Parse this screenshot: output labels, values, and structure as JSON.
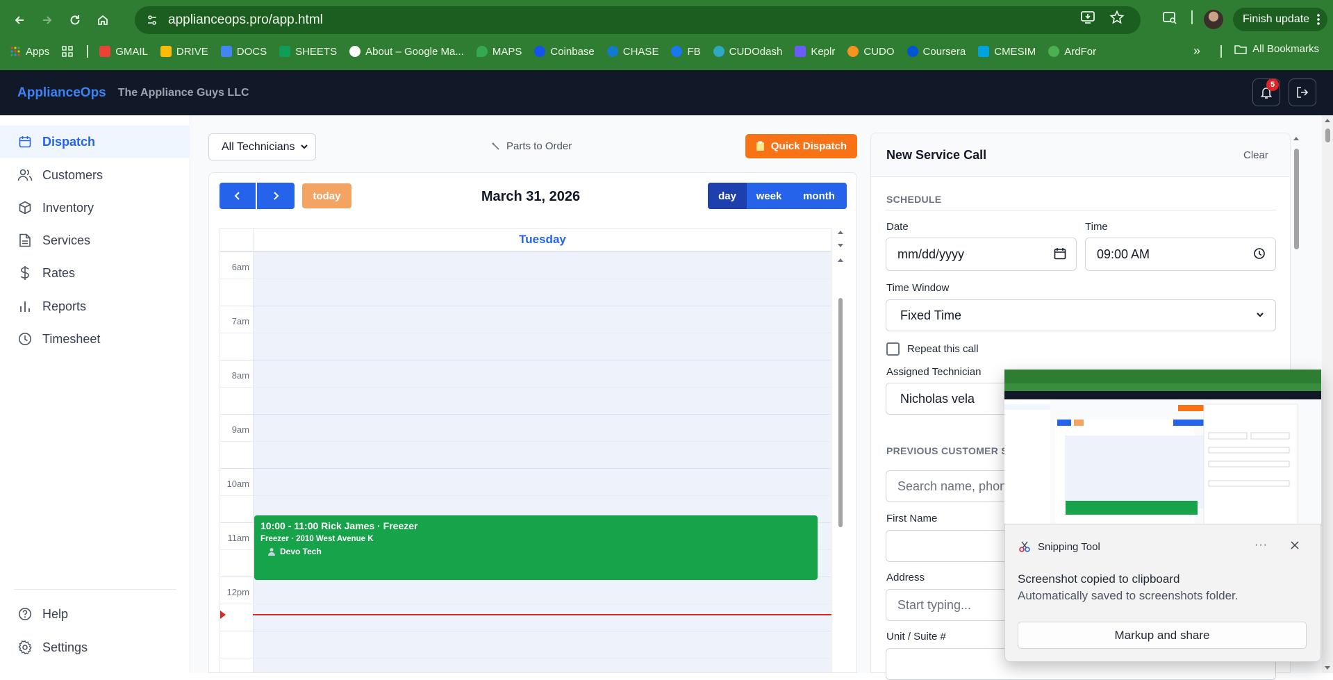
{
  "browser": {
    "url": "applianceops.pro/app.html",
    "update_label": "Finish update",
    "bookmarks": [
      {
        "label": "Apps",
        "color": "#ea4335"
      },
      {
        "label": "GMAIL",
        "color": "#ea4335"
      },
      {
        "label": "DRIVE",
        "color": "#fbbc04"
      },
      {
        "label": "DOCS",
        "color": "#4285f4"
      },
      {
        "label": "SHEETS",
        "color": "#0f9d58"
      },
      {
        "label": "About – Google Ma...",
        "color": "#ffffff"
      },
      {
        "label": "MAPS",
        "color": "#34a853"
      },
      {
        "label": "Coinbase",
        "color": "#1652f0"
      },
      {
        "label": "CHASE",
        "color": "#117aca"
      },
      {
        "label": "FB",
        "color": "#1877f2"
      },
      {
        "label": "CUDOdash",
        "color": "#2ea8c3"
      },
      {
        "label": "Keplr",
        "color": "#6b5cff"
      },
      {
        "label": "CUDO",
        "color": "#f7941d"
      },
      {
        "label": "Coursera",
        "color": "#0056d2"
      },
      {
        "label": "CMESIM",
        "color": "#00a3e0"
      },
      {
        "label": "ArdFor",
        "color": "#2e7d32"
      }
    ],
    "all_bookmarks": "All Bookmarks"
  },
  "header": {
    "brand": "ApplianceOps",
    "company": "The Appliance Guys LLC",
    "notification_count": "5"
  },
  "sidebar": {
    "items": [
      {
        "label": "Dispatch",
        "icon": "calendar-icon",
        "active": true
      },
      {
        "label": "Customers",
        "icon": "users-icon"
      },
      {
        "label": "Inventory",
        "icon": "box-icon"
      },
      {
        "label": "Services",
        "icon": "file-icon"
      },
      {
        "label": "Rates",
        "icon": "dollar-icon"
      },
      {
        "label": "Reports",
        "icon": "bar-chart-icon"
      },
      {
        "label": "Timesheet",
        "icon": "clock-icon"
      }
    ],
    "help": "Help",
    "settings": "Settings"
  },
  "dispatch": {
    "technician_filter": "All Technicians",
    "parts_link": "Parts to Order",
    "quick_dispatch": "Quick Dispatch",
    "today_label": "today",
    "calendar_title": "March 31, 2026",
    "views": [
      "day",
      "week",
      "month"
    ],
    "active_view": "day",
    "day_header": "Tuesday",
    "hours": [
      "6am",
      "7am",
      "8am",
      "9am",
      "10am",
      "11am",
      "12pm"
    ],
    "event": {
      "title": "10:00 - 11:00 Rick James · Freezer",
      "detail": "Freezer · 2010 West Avenue K",
      "tech": "Devo Tech",
      "color": "#16a34a"
    }
  },
  "service_call": {
    "title": "New Service Call",
    "clear": "Clear",
    "schedule_heading": "SCHEDULE",
    "date_label": "Date",
    "date_placeholder": "mm/dd/yyyy",
    "time_label": "Time",
    "time_value": "09:00 AM",
    "window_label": "Time Window",
    "window_value": "Fixed Time",
    "repeat_label": "Repeat this call",
    "tech_label": "Assigned Technician",
    "tech_value": "Nicholas vela",
    "prev_heading": "PREVIOUS CUSTOMER S",
    "search_placeholder": "Search name, phone",
    "first_name_label": "First Name",
    "address_label": "Address",
    "address_placeholder": "Start typing...",
    "unit_label": "Unit / Suite #"
  },
  "snip": {
    "app": "Snipping Tool",
    "headline": "Screenshot copied to clipboard",
    "subline": "Automatically saved to screenshots folder.",
    "button": "Markup and share"
  },
  "colors": {
    "chrome": "#2e7d32",
    "header": "#111827",
    "accent": "#2563eb",
    "orange": "#f97316"
  }
}
